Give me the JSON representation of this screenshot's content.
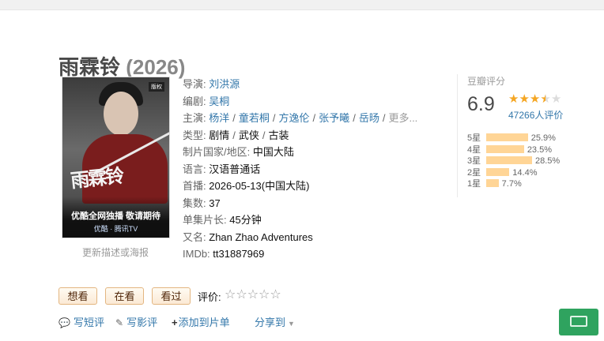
{
  "movie": {
    "title": "雨霖铃",
    "year": "(2026)"
  },
  "poster": {
    "calligraphy": "雨霖铃",
    "promo": "优酷全网独播 敬请期待",
    "platform": "优酷 · 腾讯TV",
    "badge": "版权",
    "update_link": "更新描述或海报"
  },
  "info": {
    "director_label": "导演:",
    "director": "刘洪源",
    "writer_label": "编剧:",
    "writer": "吴桐",
    "cast_label": "主演:",
    "cast": [
      "杨洋",
      "童若桐",
      "方逸伦",
      "张予曦",
      "岳旸"
    ],
    "cast_more": "更多...",
    "genre_label": "类型:",
    "genres": [
      "剧情",
      "武侠",
      "古装"
    ],
    "region_label": "制片国家/地区:",
    "region": "中国大陆",
    "language_label": "语言:",
    "language": "汉语普通话",
    "premiere_label": "首播:",
    "premiere": "2026-05-13(中国大陆)",
    "episodes_label": "集数:",
    "episodes": "37",
    "runtime_label": "单集片长:",
    "runtime": "45分钟",
    "aka_label": "又名:",
    "aka": "Zhan Zhao Adventures",
    "imdb_label": "IMDb:",
    "imdb": "tt31887969"
  },
  "rating": {
    "label": "豆瓣评分",
    "score": "6.9",
    "stars": 3.5,
    "votes": "47266人评价",
    "distribution": [
      {
        "label": "5星",
        "percent": 25.9,
        "text": "25.9%"
      },
      {
        "label": "4星",
        "percent": 23.5,
        "text": "23.5%"
      },
      {
        "label": "3星",
        "percent": 28.5,
        "text": "28.5%"
      },
      {
        "label": "2星",
        "percent": 14.4,
        "text": "14.4%"
      },
      {
        "label": "1星",
        "percent": 7.7,
        "text": "7.7%"
      }
    ],
    "bar_color": "#ffd596",
    "star_color": "#f5a623"
  },
  "actions": {
    "want": "想看",
    "watching": "在看",
    "watched": "看过",
    "rate_label": "评价:",
    "rate_star_glyph": "☆"
  },
  "links": {
    "review": "写短评",
    "long_review": "写影评",
    "add_list": "添加到片单",
    "share": "分享到"
  },
  "icons": {
    "review": "comment-icon",
    "long_review": "pencil-icon",
    "add_list": "plus-icon",
    "share": "caret-down-icon"
  }
}
